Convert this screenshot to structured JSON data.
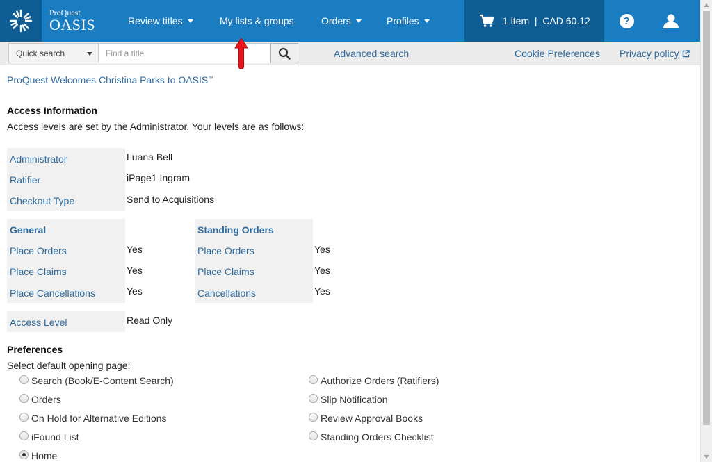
{
  "header": {
    "brand": "ProQuest",
    "product": "OASIS",
    "nav": [
      {
        "label": "Review titles",
        "dropdown": true
      },
      {
        "label": "My lists & groups",
        "dropdown": false
      },
      {
        "label": "Orders",
        "dropdown": true
      },
      {
        "label": "Profiles",
        "dropdown": true
      }
    ],
    "cart_text": "1 item  |  CAD 60.12",
    "help_label": "?"
  },
  "searchbar": {
    "select_value": "Quick search",
    "input_placeholder": "Find a title",
    "advanced_search": "Advanced search",
    "cookie_preferences": "Cookie Preferences",
    "privacy_policy": "Privacy policy"
  },
  "welcome": {
    "text": "ProQuest Welcomes Christina Parks to OASIS",
    "tm": "™"
  },
  "access": {
    "heading": "Access Information",
    "description": "Access levels are set by the Administrator. Your levels are as follows:",
    "rows": [
      {
        "label": "Administrator",
        "value": "Luana Bell"
      },
      {
        "label": "Ratifier",
        "value": "iPage1 Ingram"
      },
      {
        "label": "Checkout Type",
        "value": "Send to Acquisitions"
      }
    ],
    "general": {
      "heading": "General",
      "rows": [
        {
          "label": "Place Orders",
          "value": "Yes"
        },
        {
          "label": "Place Claims",
          "value": "Yes"
        },
        {
          "label": "Place Cancellations",
          "value": "Yes"
        }
      ]
    },
    "standing_orders": {
      "heading": "Standing Orders",
      "rows": [
        {
          "label": "Place Orders",
          "value": "Yes"
        },
        {
          "label": "Place Claims",
          "value": "Yes"
        },
        {
          "label": "Cancellations",
          "value": "Yes"
        }
      ]
    },
    "access_level": {
      "label": "Access Level",
      "value": "Read Only"
    }
  },
  "preferences": {
    "heading": "Preferences",
    "description": "Select default opening page:",
    "left_options": [
      {
        "label": "Search (Book/E-Content Search)",
        "checked": false
      },
      {
        "label": "Orders",
        "checked": false
      },
      {
        "label": "On Hold for Alternative Editions",
        "checked": false
      },
      {
        "label": "iFound List",
        "checked": false
      },
      {
        "label": "Home",
        "checked": true
      }
    ],
    "right_options": [
      {
        "label": "Authorize Orders (Ratifiers)",
        "checked": false
      },
      {
        "label": "Slip Notification",
        "checked": false
      },
      {
        "label": "Review Approval Books",
        "checked": false
      },
      {
        "label": "Standing Orders Checklist",
        "checked": false
      }
    ]
  },
  "colors": {
    "nav_bg": "#1a7cc1",
    "nav_dark": "#0e5d94",
    "link": "#2c6aa0",
    "annotation_arrow": "#e8151b"
  }
}
